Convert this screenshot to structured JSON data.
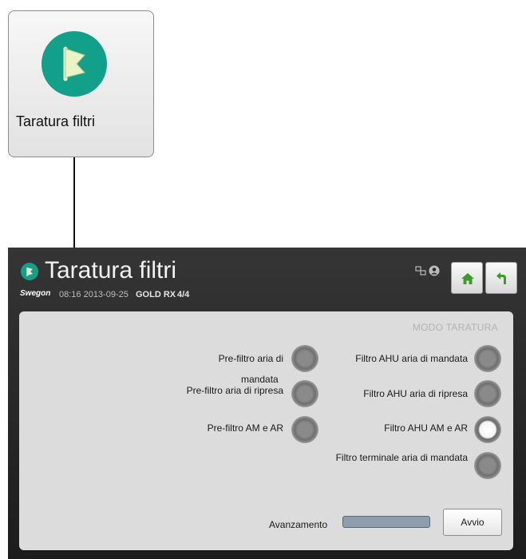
{
  "tile": {
    "label": "Taratura filtri",
    "icon": "flag-icon"
  },
  "screen": {
    "title": "Taratura filtri",
    "brand": "Swegon",
    "time_date": "08:16 2013-09-25",
    "model": "GOLD RX",
    "page": "4/4",
    "status_icons": [
      "network-icon",
      "user-icon"
    ],
    "nav": {
      "home_icon": "home-icon",
      "back_icon": "back-icon"
    },
    "mode_label": "MODO TARATURA",
    "options": [
      {
        "label": "Pre-filtro aria di mandata",
        "line1": "Pre-filtro aria di",
        "line2": "mandata",
        "selected": false
      },
      {
        "label": "Pre-filtro aria di ripresa",
        "selected": false
      },
      {
        "label": "Pre-filtro AM e AR",
        "selected": false
      },
      {
        "label": "Filtro AHU aria di mandata",
        "selected": false
      },
      {
        "label": "Filtro AHU aria di ripresa",
        "selected": false
      },
      {
        "label": "Filtro AHU AM e AR",
        "selected": true
      },
      {
        "label": "Filtro terminale aria di mandata",
        "selected": false
      }
    ],
    "progress_label": "Avanzamento",
    "progress_value": 0,
    "start_button": "Avvio"
  },
  "colors": {
    "accent": "#12a08a",
    "panel": "#dcdcdc",
    "header": "#2b2b2b"
  }
}
